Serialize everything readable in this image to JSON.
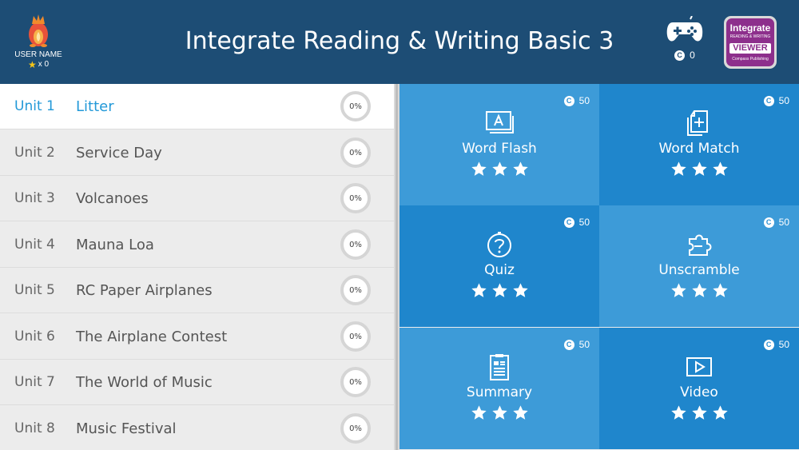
{
  "header": {
    "title": "Integrate Reading & Writing Basic 3",
    "user_name": "USER NAME",
    "star_count": "x 0",
    "game_coins": "0",
    "viewer": {
      "line1": "Integrate",
      "line2": "READING & WRITING",
      "line3": "VIEWER",
      "line4": "Compass Publishing"
    }
  },
  "units": [
    {
      "num": "Unit 1",
      "name": "Litter",
      "progress": "0%",
      "active": true
    },
    {
      "num": "Unit 2",
      "name": "Service Day",
      "progress": "0%"
    },
    {
      "num": "Unit 3",
      "name": "Volcanoes",
      "progress": "0%"
    },
    {
      "num": "Unit 4",
      "name": "Mauna Loa",
      "progress": "0%"
    },
    {
      "num": "Unit 5",
      "name": "RC Paper Airplanes",
      "progress": "0%"
    },
    {
      "num": "Unit 6",
      "name": "The Airplane Contest",
      "progress": "0%"
    },
    {
      "num": "Unit 7",
      "name": "The World of Music",
      "progress": "0%"
    },
    {
      "num": "Unit 8",
      "name": "Music Festival",
      "progress": "0%"
    }
  ],
  "activities": [
    {
      "label": "Word Flash",
      "cost": "50",
      "icon": "word-flash-icon",
      "stars": 3
    },
    {
      "label": "Word Match",
      "cost": "50",
      "icon": "word-match-icon",
      "stars": 3
    },
    {
      "label": "Quiz",
      "cost": "50",
      "icon": "quiz-icon",
      "stars": 3
    },
    {
      "label": "Unscramble",
      "cost": "50",
      "icon": "puzzle-icon",
      "stars": 3
    },
    {
      "label": "Summary",
      "cost": "50",
      "icon": "summary-icon",
      "stars": 3
    },
    {
      "label": "Video",
      "cost": "50",
      "icon": "video-icon",
      "stars": 3
    }
  ],
  "colors": {
    "header_bg": "#1d4d75",
    "tile_light": "#3d9bd8",
    "tile_dark": "#1f86cc",
    "active_unit": "#2399d8",
    "viewer_bg": "#8d2f8c"
  }
}
